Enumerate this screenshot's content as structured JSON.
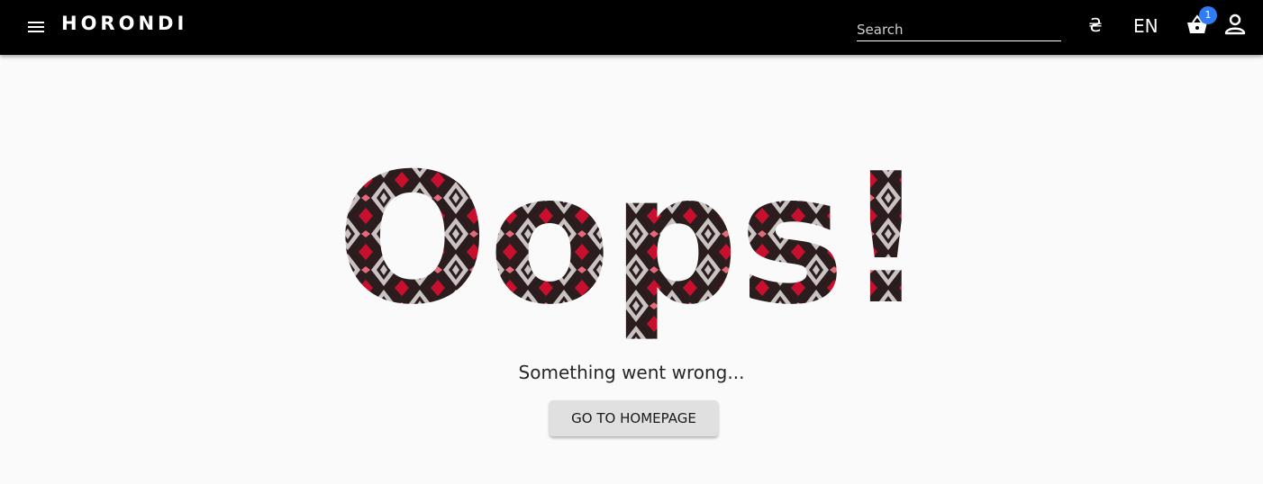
{
  "header": {
    "logo": "HORONDI",
    "search": {
      "placeholder": "Search",
      "value": ""
    },
    "currency_symbol": "₴",
    "language": "EN",
    "cart_count": "1",
    "icons": [
      "menu-icon",
      "hryvnia-icon",
      "basket-icon",
      "user-icon"
    ]
  },
  "error": {
    "headline": "Oops!",
    "message": "Something went wrong...",
    "button_label": "GO TO HOMEPAGE"
  },
  "colors": {
    "appbar": "#000000",
    "background": "#fafafa",
    "badge": "#2f7df6",
    "pattern_red": "#c8102e",
    "pattern_pink": "#e46a78",
    "pattern_dark": "#2b1d1e",
    "pattern_light": "#c9c3c3"
  }
}
